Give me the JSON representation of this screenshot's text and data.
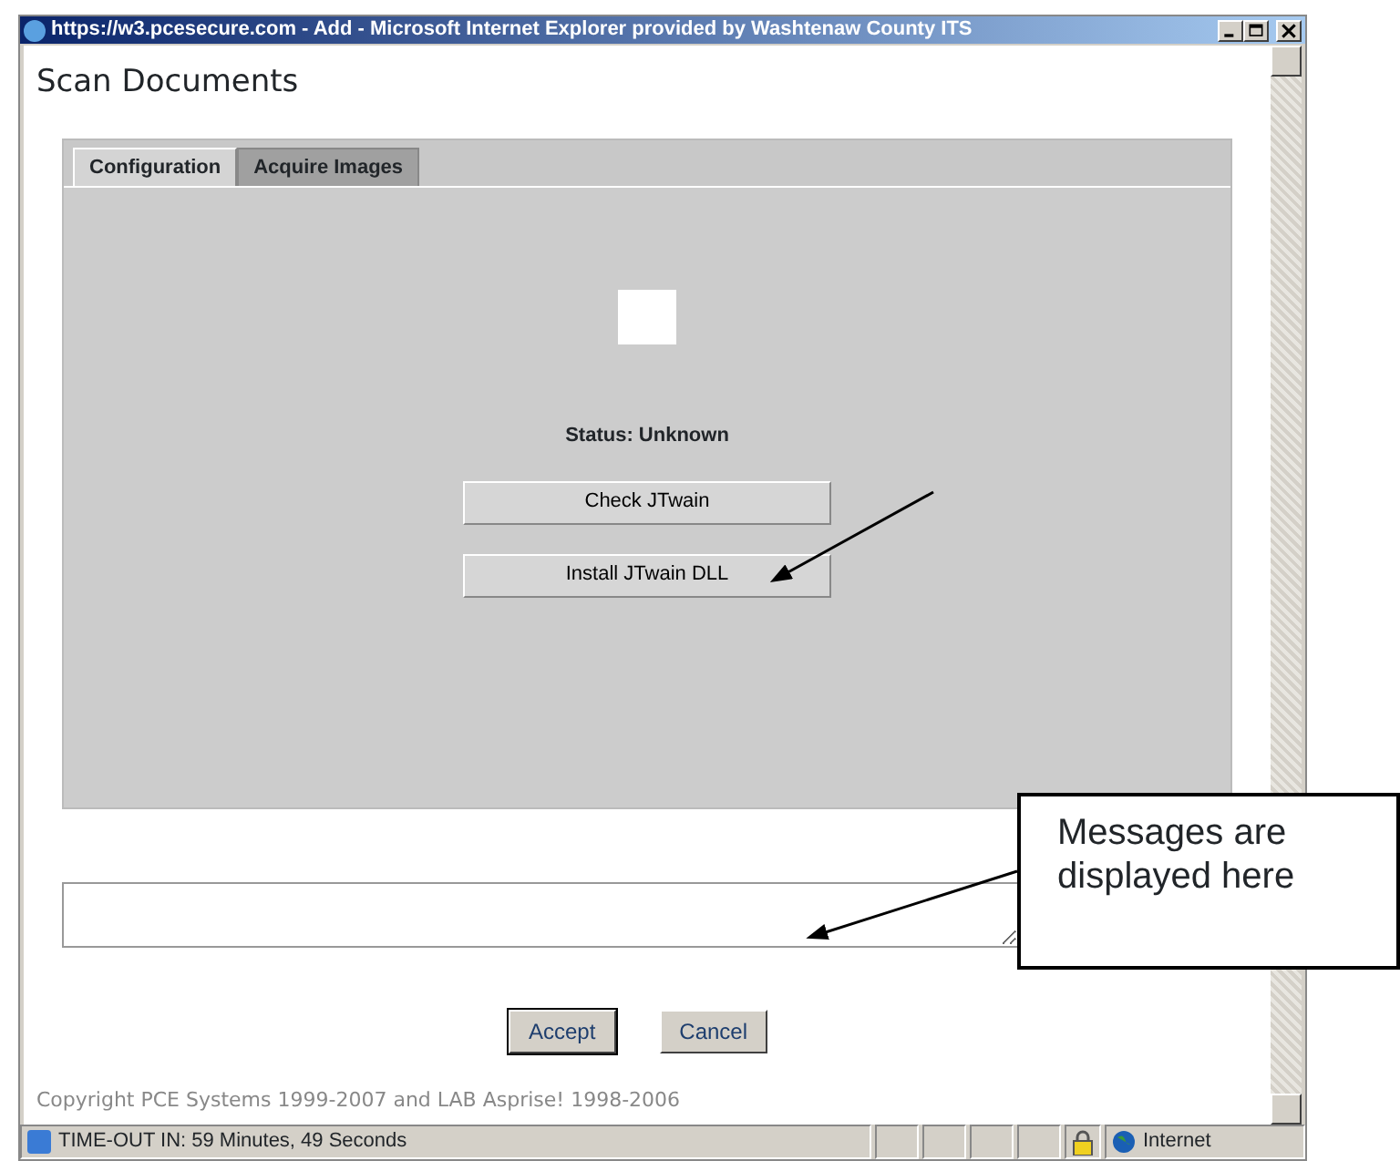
{
  "window": {
    "title": "https://w3.pcesecure.com - Add - Microsoft Internet Explorer provided by Washtenaw County ITS"
  },
  "page": {
    "heading": "Scan Documents",
    "tabs": [
      {
        "label": "Configuration",
        "selected": true
      },
      {
        "label": "Acquire Images",
        "selected": false
      }
    ],
    "status": "Status: Unknown",
    "panel_buttons": [
      "Check JTwain",
      "Install JTwain DLL"
    ],
    "buttons": [
      {
        "label": "Accept",
        "default": true
      },
      {
        "label": "Cancel",
        "default": false
      }
    ],
    "copyright": "Copyright PCE Systems 1999-2007 and LAB Asprise! 1998-2006"
  },
  "status_bar": {
    "text": "TIME-OUT IN: 59 Minutes, 49 Seconds",
    "zone": "Internet"
  },
  "callout": {
    "text": "Messages are displayed here"
  }
}
